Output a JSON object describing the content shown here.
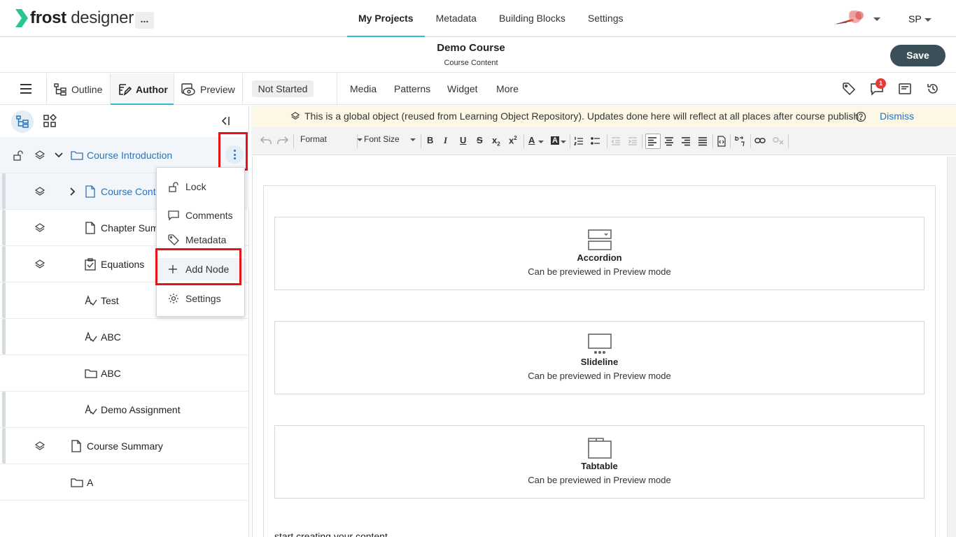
{
  "app": {
    "logo_bold": "frost",
    "logo_rest": "designer",
    "more_label": "..."
  },
  "nav": {
    "items": [
      "My Projects",
      "Metadata",
      "Building Blocks",
      "Settings"
    ],
    "active": "My Projects"
  },
  "user": {
    "initials": "SP"
  },
  "course": {
    "title": "Demo Course",
    "subtitle": "Course Content",
    "save_label": "Save"
  },
  "toolbar": {
    "outline_label": "Outline",
    "author_label": "Author",
    "preview_label": "Preview",
    "status": "Not Started",
    "insert_tabs": [
      "Media",
      "Patterns",
      "Widget",
      "More"
    ],
    "comment_badge": "1"
  },
  "tree": {
    "items": [
      {
        "label": "Course Introduction"
      },
      {
        "label": "Course Conte"
      },
      {
        "label": "Chapter Sum"
      },
      {
        "label": "Equations"
      },
      {
        "label": "Test"
      },
      {
        "label": "ABC"
      },
      {
        "label": "ABC"
      },
      {
        "label": "Demo Assignment"
      },
      {
        "label": "Course Summary"
      },
      {
        "label": "A"
      }
    ]
  },
  "context_menu": {
    "items": [
      "Lock",
      "Comments",
      "Metadata",
      "Add Node",
      "Settings"
    ]
  },
  "notice": {
    "text": "This is a global object (reused from Learning Object Repository). Updates done here will reflect at all places after course publish.",
    "dismiss_label": "Dismiss"
  },
  "editor": {
    "format_label": "Format",
    "font_size_label": "Font Size",
    "blocks": [
      {
        "name": "Accordion",
        "desc": "Can be previewed in Preview mode"
      },
      {
        "name": "Slideline",
        "desc": "Can be previewed in Preview mode"
      },
      {
        "name": "Tabtable",
        "desc": "Can be previewed in Preview mode"
      }
    ],
    "placeholder_text": "start creating your content..."
  },
  "colors": {
    "accent": "#36b8d6",
    "link_blue": "#2c72b8",
    "save_bg": "#3b4f59",
    "highlight_red": "#e3131a",
    "notice_bg": "#fdf8e6",
    "badge_red": "#e53935"
  }
}
